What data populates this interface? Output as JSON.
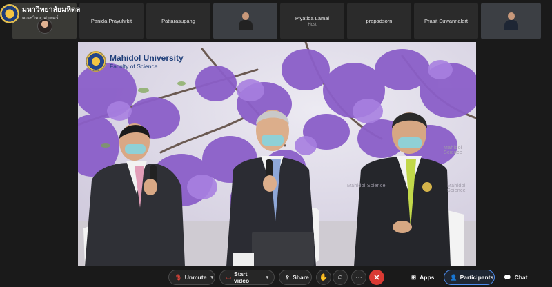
{
  "brand": {
    "title": "มหาวิทยาลัยมหิดล",
    "subtitle": "คณะวิทยาศาสตร์"
  },
  "participants": [
    {
      "name": "Panida Prayuhrkit",
      "role": ""
    },
    {
      "name": "Pattarasupang",
      "role": ""
    },
    {
      "name": "",
      "role": ""
    },
    {
      "name": "Piyatida Lamai",
      "role": "Host"
    },
    {
      "name": "prapadsorn",
      "role": ""
    },
    {
      "name": "Prasit Suwannalert",
      "role": ""
    },
    {
      "name": "",
      "role": ""
    }
  ],
  "stage": {
    "university": "Mahidol University",
    "faculty": "Faculty of Science",
    "watermark": "Mahidol Science"
  },
  "toolbar": {
    "unmute": "Unmute",
    "start_video": "Start video",
    "share": "Share",
    "apps": "Apps",
    "participants": "Participants",
    "chat": "Chat"
  },
  "colors": {
    "end_call": "#d93a33",
    "muted_icon": "#e6453a",
    "active_outline": "#4d8df0"
  }
}
